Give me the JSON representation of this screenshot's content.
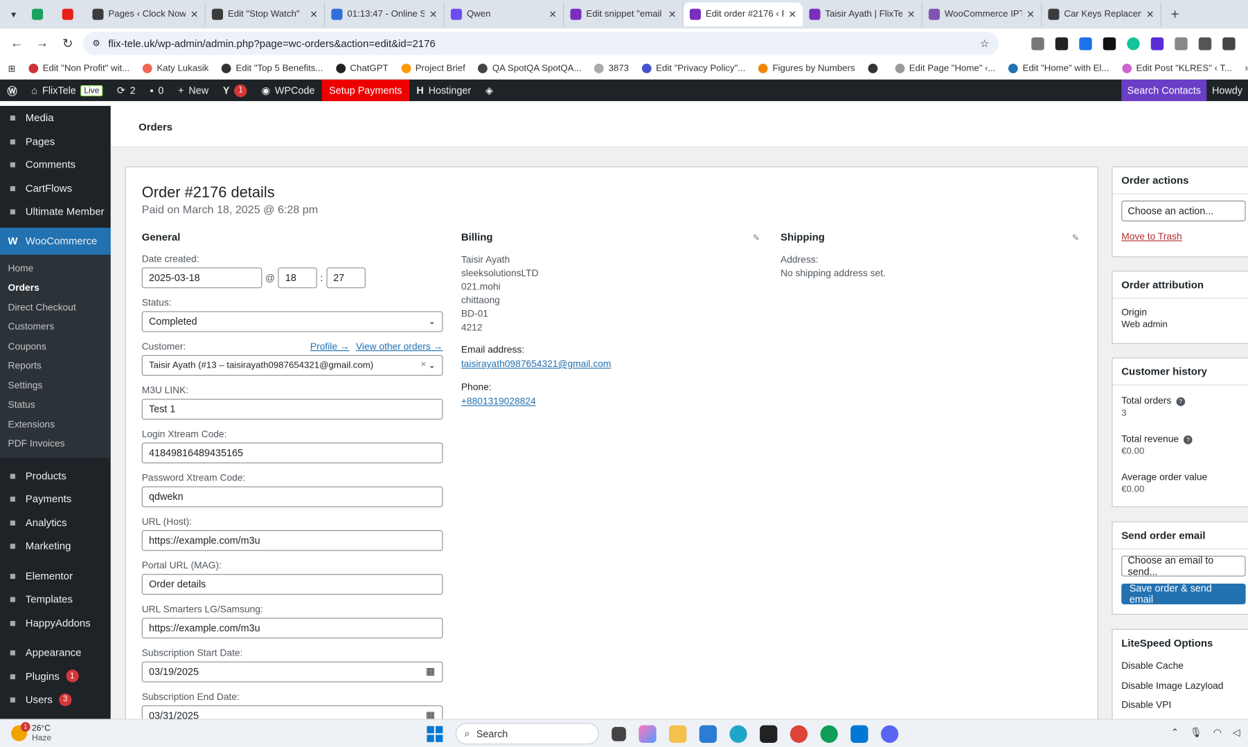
{
  "browser": {
    "tabs": [
      {
        "label": "",
        "icon_color": "#1aa260",
        "close": ""
      },
      {
        "label": "",
        "icon_color": "#e62117",
        "close": ""
      },
      {
        "label": "Pages ‹ Clock Now",
        "icon_color": "#3c3c3c",
        "close": "✕"
      },
      {
        "label": "Edit \"Stop Watch\"",
        "icon_color": "#3c3c3c",
        "close": "✕"
      },
      {
        "label": "01:13:47 - Online St",
        "icon_color": "#2f6fdd",
        "close": "✕"
      },
      {
        "label": "Qwen",
        "icon_color": "#6a4df5",
        "close": "✕"
      },
      {
        "label": "Edit snippet \"email",
        "icon_color": "#7b2fbe",
        "close": "✕"
      },
      {
        "label": "Edit order #2176 ‹ F",
        "icon_color": "#7b2fbe",
        "close": "✕"
      },
      {
        "label": "Taisir Ayath | FlixTel",
        "icon_color": "#7b2fbe",
        "close": "✕"
      },
      {
        "label": "WooCommerce IPT",
        "icon_color": "#7f54b3",
        "close": "✕"
      },
      {
        "label": "Car Keys Replacem",
        "icon_color": "#3c3c3c",
        "close": "✕"
      }
    ],
    "active_tab_index": 7,
    "new_tab": "+",
    "url": "flix-tele.uk/wp-admin/admin.php?page=wc-orders&action=edit&id=2176",
    "bookmarks": [
      "Edit \"Non Profit\" wit...",
      "Katy Lukasik",
      "Edit \"Top 5 Benefits...",
      "ChatGPT",
      "Project Brief",
      "QA SpotQA SpotQA...",
      "3873",
      "Edit \"Privacy Policy\"...",
      "Figures by Numbers",
      "",
      "Edit Page \"Home\" ‹...",
      "Edit \"Home\" with El...",
      "Edit Post \"KLRES\" ‹ T..."
    ],
    "more_bookmarks": "»"
  },
  "adminbar": {
    "site": "FlixTele",
    "live": "Live",
    "updates": "2",
    "comments": "0",
    "new": "New",
    "yoast_count": "1",
    "wpcode": "WPCode",
    "setup_payments": "Setup Payments",
    "hostinger": "Hostinger",
    "search_contacts": "Search Contacts",
    "howdy": "Howdy"
  },
  "sidebar": {
    "top": [
      {
        "label": "Media",
        "icon": "media-icon"
      },
      {
        "label": "Pages",
        "icon": "pages-icon"
      },
      {
        "label": "Comments",
        "icon": "comments-icon"
      },
      {
        "label": "CartFlows",
        "icon": "cartflows-icon"
      },
      {
        "label": "Ultimate Member",
        "icon": "user-icon"
      }
    ],
    "woocommerce": "WooCommerce",
    "sub": [
      "Home",
      "Orders",
      "Direct Checkout",
      "Customers",
      "Coupons",
      "Reports",
      "Settings",
      "Status",
      "Extensions",
      "PDF Invoices"
    ],
    "bottom1": [
      {
        "label": "Products",
        "icon": "products-icon",
        "badge": ""
      },
      {
        "label": "Payments",
        "icon": "payments-icon",
        "badge": ""
      },
      {
        "label": "Analytics",
        "icon": "analytics-icon",
        "badge": ""
      },
      {
        "label": "Marketing",
        "icon": "marketing-icon",
        "badge": ""
      }
    ],
    "bottom2": [
      {
        "label": "Elementor",
        "icon": "elementor-icon",
        "badge": ""
      },
      {
        "label": "Templates",
        "icon": "folder-icon",
        "badge": ""
      },
      {
        "label": "HappyAddons",
        "icon": "happyaddons-icon",
        "badge": ""
      }
    ],
    "bottom3": [
      {
        "label": "Appearance",
        "icon": "appearance-icon",
        "badge": ""
      },
      {
        "label": "Plugins",
        "icon": "plugins-icon",
        "badge": "1"
      },
      {
        "label": "Users",
        "icon": "users-icon",
        "badge": "3"
      }
    ]
  },
  "page": {
    "header": "Orders",
    "title": "Order #2176 details",
    "paid": "Paid on March 18, 2025 @ 6:28 pm"
  },
  "general": {
    "heading": "General",
    "date_label": "Date created:",
    "date": "2025-03-18",
    "at": "@",
    "hour": "18",
    "colon": ":",
    "minute": "27",
    "status_label": "Status:",
    "status": "Completed",
    "customer_label": "Customer:",
    "profile_link": "Profile →",
    "other_orders_link": "View other orders →",
    "customer": "Taisir Ayath (#13 – taisirayath0987654321@gmail.com)",
    "clear": "×",
    "fields": [
      {
        "label": "M3U LINK:",
        "value": "Test 1",
        "type": "text"
      },
      {
        "label": "Login Xtream Code:",
        "value": "41849816489435165",
        "type": "text"
      },
      {
        "label": "Password Xtream Code:",
        "value": "qdwekn",
        "type": "text"
      },
      {
        "label": "URL (Host):",
        "value": "https://example.com/m3u",
        "type": "text"
      },
      {
        "label": "Portal URL (MAG):",
        "value": "Order details",
        "type": "text"
      },
      {
        "label": "URL Smarters LG/Samsung:",
        "value": "https://example.com/m3u",
        "type": "text"
      },
      {
        "label": "Subscription Start Date:",
        "value": "03/19/2025",
        "type": "date"
      },
      {
        "label": "Subscription End Date:",
        "value": "03/31/2025",
        "type": "date"
      }
    ]
  },
  "billing": {
    "heading": "Billing",
    "address": [
      "Taisir Ayath",
      "sleeksolutionsLTD",
      "021.mohi",
      "chittaong",
      "BD-01",
      "4212"
    ],
    "email_label": "Email address:",
    "email": "taisirayath0987654321@gmail.com",
    "phone_label": "Phone:",
    "phone": "+8801319028824"
  },
  "shipping": {
    "heading": "Shipping",
    "address_label": "Address:",
    "address": "No shipping address set."
  },
  "actions": {
    "heading": "Order actions",
    "select": "Choose an action...",
    "trash": "Move to Trash"
  },
  "attribution": {
    "heading": "Order attribution",
    "origin_label": "Origin",
    "origin": "Web admin"
  },
  "history": {
    "heading": "Customer history",
    "total_orders_label": "Total orders",
    "total_orders": "3",
    "total_revenue_label": "Total revenue",
    "total_revenue": "€0.00",
    "aov_label": "Average order value",
    "aov": "€0.00"
  },
  "send_email": {
    "heading": "Send order email",
    "select": "Choose an email to send...",
    "button": "Save order & send email"
  },
  "litespeed": {
    "heading": "LiteSpeed Options",
    "items": [
      "Disable Cache",
      "Disable Image Lazyload",
      "Disable VPI"
    ]
  },
  "taskbar": {
    "temp": "26°C",
    "weather": "Haze",
    "weather_badge": "1",
    "search": "Search"
  },
  "colors": {
    "accent": "#2271b1",
    "adminbar": "#1d2327",
    "setup": "#e00000",
    "search_contacts": "#6a3ec6"
  }
}
